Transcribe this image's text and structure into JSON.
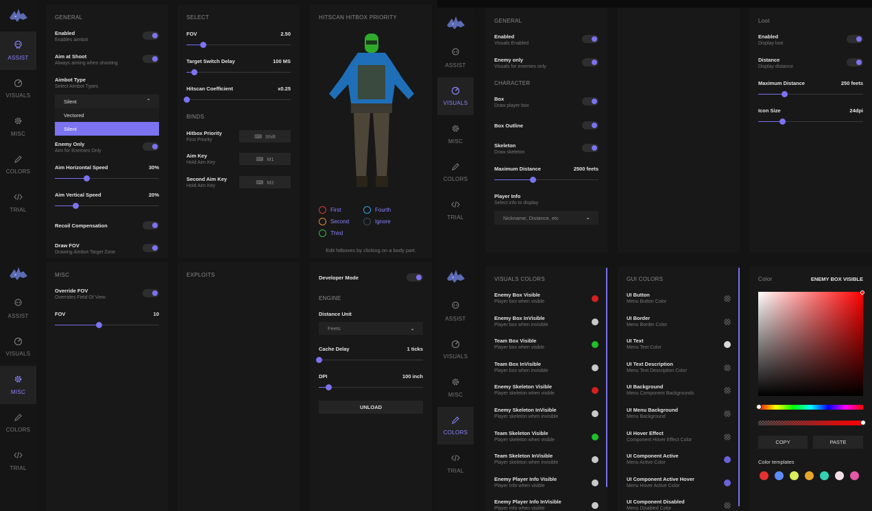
{
  "nav": {
    "items": [
      {
        "key": "assist",
        "label": "ASSIST"
      },
      {
        "key": "visuals",
        "label": "VISUALS"
      },
      {
        "key": "misc",
        "label": "MISC"
      },
      {
        "key": "colors",
        "label": "COLORS"
      },
      {
        "key": "trial",
        "label": "TRIAL"
      }
    ]
  },
  "aim": {
    "general_title": "GENERAL",
    "enabled": {
      "label": "Enabled",
      "desc": "Enables aimbot"
    },
    "aim_shoot": {
      "label": "Aim at Shoot",
      "desc": "Always aiming when shooting"
    },
    "aimbot_type": {
      "label": "Aimbot Type",
      "desc": "Select Aimbot Types",
      "value": "Silent",
      "options": [
        "Vectored",
        "Silent"
      ]
    },
    "enemy_only": {
      "label": "Enemy Only",
      "desc": "Aim for Enemies Only"
    },
    "hspeed": {
      "label": "Aim Horizontal Speed",
      "value": "30%",
      "pct": 30
    },
    "vspeed": {
      "label": "Aim Vertical Speed",
      "value": "20%",
      "pct": 20
    },
    "recoil": {
      "label": "Recoil Compensation"
    },
    "drawfov": {
      "label": "Draw FOV",
      "desc": "Drawing Aimbot Target Zone"
    },
    "select_title": "SELECT",
    "fov": {
      "label": "FOV",
      "value": "2.50",
      "pct": 16
    },
    "switch_delay": {
      "label": "Target Switch Delay",
      "value": "100 MS",
      "pct": 7
    },
    "hitscan_coef": {
      "label": "Hitscan Coefficient",
      "value": "x0.25",
      "pct": 0
    },
    "binds_title": "BINDS",
    "hitbox_priority": {
      "label": "Hitbox Priority",
      "desc": "First Priority",
      "key": "Shift"
    },
    "aim_key": {
      "label": "Aim Key",
      "desc": "Hold Aim Key",
      "key": "M1"
    },
    "second_aim_key": {
      "label": "Second Aim Key",
      "desc": "Hold Aim Key",
      "key": "M2"
    },
    "hitbox_title": "HITSCAN HITBOX PRIORITY",
    "legend": [
      {
        "label": "First",
        "color": "#e03a3a"
      },
      {
        "label": "Fourth",
        "color": "#2aa9e0"
      },
      {
        "label": "Second",
        "color": "#e0922a"
      },
      {
        "label": "Ignore",
        "color": "#3d4a5c"
      },
      {
        "label": "Third",
        "color": "#39b84a"
      }
    ],
    "hitbox_hint": "Edit hitboxes by clicking on a body part."
  },
  "misc": {
    "misc_title": "MISC",
    "override_fov": {
      "label": "Override FOV",
      "desc": "Overrides Field Of View"
    },
    "fov": {
      "label": "FOV",
      "value": "10",
      "pct": 42
    },
    "exploits_title": "EXPLOITS",
    "dev_mode": {
      "label": "Developer Mode"
    },
    "engine_title": "ENGINE",
    "distance_unit": {
      "label": "Distance Unit",
      "value": "Feets"
    },
    "cache_delay": {
      "label": "Cache Delay",
      "value": "1 ticks",
      "pct": 0
    },
    "dpi": {
      "label": "DPI",
      "value": "100 inch",
      "pct": 9
    },
    "unload": "UNLOAD"
  },
  "visuals": {
    "general_title": "GENERAL",
    "enabled": {
      "label": "Enabled",
      "desc": "Visuals Enabled"
    },
    "enemy_only": {
      "label": "Enemy only",
      "desc": "Visuals for enemies only"
    },
    "character_title": "CHARACTER",
    "box": {
      "label": "Box",
      "desc": "Draw player box"
    },
    "box_outline": {
      "label": "Box Outline"
    },
    "skeleton": {
      "label": "Skeleton",
      "desc": "Draw skeleton"
    },
    "max_distance": {
      "label": "Maximum Distance",
      "value": "2500 feets",
      "pct": 37
    },
    "player_info": {
      "label": "Player Info",
      "desc": "Select info to display",
      "value": "Nickname, Distance, etc"
    },
    "loot_title": "Loot",
    "loot_enabled": {
      "label": "Enabled",
      "desc": "Display loot"
    },
    "loot_distance": {
      "label": "Distance",
      "desc": "Display distance"
    },
    "loot_max_distance": {
      "label": "Maximum Distance",
      "value": "250 feets",
      "pct": 25
    },
    "icon_size": {
      "label": "Icon Size",
      "value": "24dpi",
      "pct": 23
    }
  },
  "colors": {
    "visuals_title": "VISUALS COLORS",
    "visuals_items": [
      {
        "label": "Enemy Box Visible",
        "desc": "Player box when visible",
        "color": "#d61f1f"
      },
      {
        "label": "Enemy Box InVisible",
        "desc": "Player box when invisible",
        "color": "#c8c8c8"
      },
      {
        "label": "Team Box Visible",
        "desc": "Player box when visible",
        "color": "#1fbf2a"
      },
      {
        "label": "Team Box InVisible",
        "desc": "Player box when invisible",
        "color": "#c8c8c8"
      },
      {
        "label": "Enemy Skeleton Visible",
        "desc": "Player skeleton when visible",
        "color": "#d61f1f"
      },
      {
        "label": "Enemy Skeleton InVisible",
        "desc": "Player skeleton when invisible",
        "color": "#c8c8c8"
      },
      {
        "label": "Team Skeleton Visible",
        "desc": "Player skeleton when visible",
        "color": "#1fbf2a"
      },
      {
        "label": "Team Skeleton InVisible",
        "desc": "Player skeleton when invisible",
        "color": "#c8c8c8"
      },
      {
        "label": "Enemy Player Info Visible",
        "desc": "Player Info when visible",
        "color": "#c8c8c8"
      },
      {
        "label": "Enemy Player Info InVisible",
        "desc": "Player Info when visible",
        "color": "#c8c8c8"
      }
    ],
    "gui_title": "GUI COLORS",
    "gui_items": [
      {
        "label": "UI Button",
        "desc": "Menu Button Color",
        "color": "checker"
      },
      {
        "label": "UI Border",
        "desc": "Menu Border Color",
        "color": "checker"
      },
      {
        "label": "UI Text",
        "desc": "Menu Text Color",
        "color": "#d8d8d8"
      },
      {
        "label": "UI Text Description",
        "desc": "Menu Text Description Color",
        "color": "checker"
      },
      {
        "label": "UI Background",
        "desc": "Menu Component Backgrounds",
        "color": "checker"
      },
      {
        "label": "UI Menu Background",
        "desc": "Menu Background",
        "color": "checker"
      },
      {
        "label": "UI Hover Effect",
        "desc": "Component Hover Effect Color",
        "color": "checker"
      },
      {
        "label": "UI Component Active",
        "desc": "Menu Active Color",
        "color": "#6a63d8"
      },
      {
        "label": "UI Component Active Hover",
        "desc": "Menu Hover Active Color",
        "color": "#6a63d8"
      },
      {
        "label": "UI Component Disabled",
        "desc": "Menu Disabled Color",
        "color": "checker"
      }
    ],
    "picker_label": "Color",
    "picker_target": "ENEMY BOX VISIBLE",
    "picker_hue": "#ff0000",
    "copy": "COPY",
    "paste": "PASTE",
    "templates_label": "Color templates",
    "templates": [
      "#e53131",
      "#5e8cf5",
      "#d9ec5a",
      "#e6a52a",
      "#33d1b4",
      "#f3dde6",
      "#e658a7"
    ]
  }
}
